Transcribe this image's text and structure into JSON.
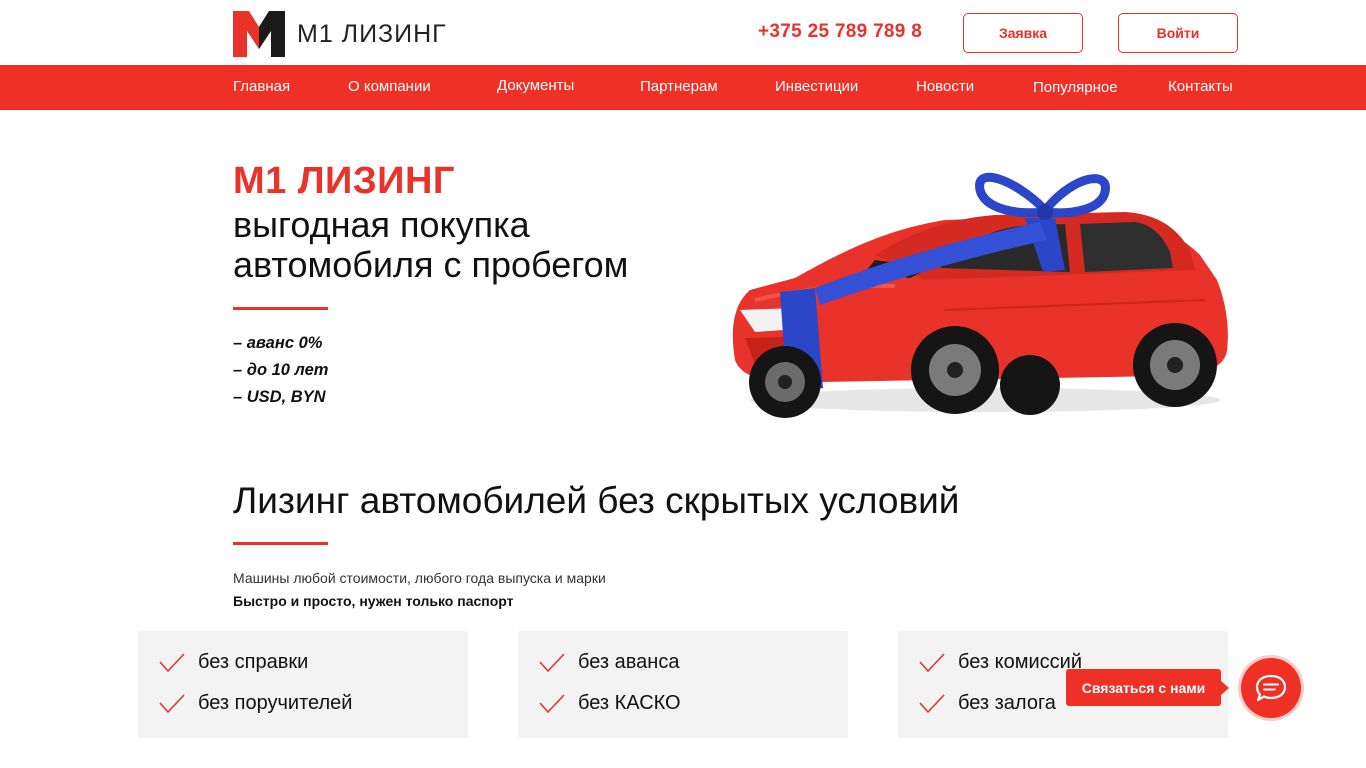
{
  "header": {
    "logo_text": "М1 ЛИЗИНГ",
    "phone": "+375 25 789 789 8",
    "request_label": "Заявка",
    "login_label": "Войти"
  },
  "nav": {
    "items": [
      {
        "label": "Главная"
      },
      {
        "label": "О компании"
      },
      {
        "label": "Документы"
      },
      {
        "label": "Партнерам"
      },
      {
        "label": "Инвестиции"
      },
      {
        "label": "Новости"
      },
      {
        "label": "Популярное"
      },
      {
        "label": "Контакты"
      }
    ]
  },
  "hero": {
    "brand": "М1 ЛИЗИНГ",
    "line1": "выгодная покупка",
    "line2": "автомобиля с пробегом",
    "features": [
      "– аванс 0%",
      "– до 10 лет",
      "– USD, BYN"
    ],
    "image_icon": "red-car-with-blue-ribbon"
  },
  "section": {
    "title": "Лизинг автомобилей без скрытых условий",
    "subtitle": "Машины любой стоимости, любого года выпуска и марки",
    "subtitle_bold": "Быстро и просто, нужен только паспорт"
  },
  "cards": [
    {
      "items": [
        "без справки",
        "без поручителей"
      ]
    },
    {
      "items": [
        "без аванса",
        "без КАСКО"
      ]
    },
    {
      "items": [
        "без комиссий",
        "без залога"
      ]
    }
  ],
  "chat": {
    "label": "Связаться с нами",
    "icon": "chat-bubble-icon"
  },
  "colors": {
    "accent": "#ee3124",
    "text": "#111111",
    "card_bg": "#f3f3f3",
    "ribbon": "#2b46c8"
  }
}
